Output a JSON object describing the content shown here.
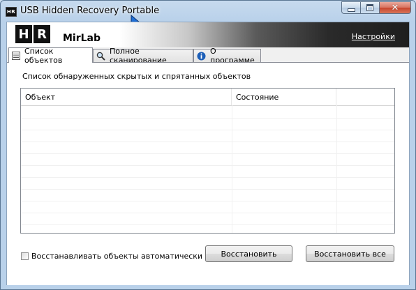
{
  "window": {
    "title": "USB Hidden Recovery Portable",
    "icon_text": "HR",
    "close_glyph": "✕"
  },
  "banner": {
    "logo_letters": [
      "H",
      "R"
    ],
    "brand": "MirLab",
    "settings_link": "Настройки"
  },
  "tabs": [
    {
      "label": "Список объектов",
      "icon": "list-icon",
      "active": true
    },
    {
      "label": "Полное сканирование",
      "icon": "magnifier-icon",
      "active": false
    },
    {
      "label": "О программе",
      "icon": "info-icon",
      "active": false
    }
  ],
  "panel": {
    "label": "Список обнаруженных скрытых и спрятанных объектов",
    "list": {
      "columns": [
        "Объект",
        "Состояние",
        ""
      ],
      "rows": []
    },
    "auto_restore_checkbox": {
      "label": "Восстанавливать объекты автоматически",
      "checked": false
    },
    "restore_button": "Восстановить",
    "restore_all_button": "Восстановить все"
  },
  "colors": {
    "frame": "#b9d1ea",
    "close_button": "#c7452c",
    "link": "#ffffff"
  }
}
